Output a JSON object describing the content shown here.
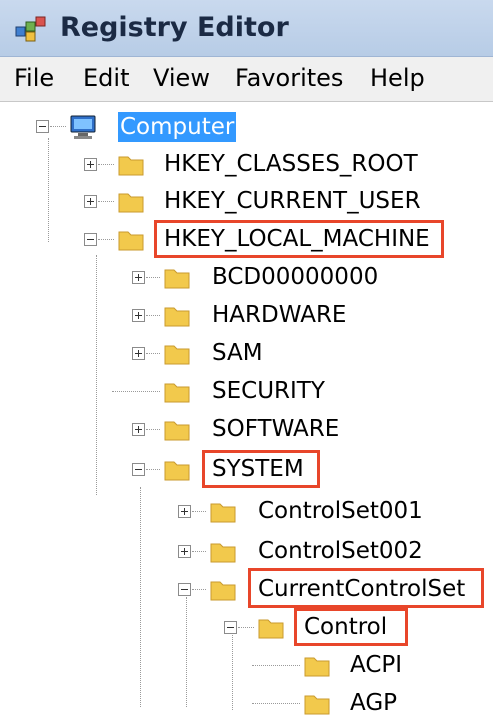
{
  "window": {
    "title": "Registry Editor"
  },
  "menu": [
    "File",
    "Edit",
    "View",
    "Favorites",
    "Help"
  ],
  "tree": {
    "root": "Computer",
    "hives": {
      "classes_root": "HKEY_CLASSES_ROOT",
      "current_user": "HKEY_CURRENT_USER",
      "local_machine": "HKEY_LOCAL_MACHINE"
    },
    "hklm_children": {
      "bcd": "BCD00000000",
      "hardware": "HARDWARE",
      "sam": "SAM",
      "security": "SECURITY",
      "software": "SOFTWARE",
      "system": "SYSTEM"
    },
    "system_children": {
      "cs001": "ControlSet001",
      "cs002": "ControlSet002",
      "ccs": "CurrentControlSet"
    },
    "ccs_children": {
      "control": "Control"
    },
    "control_children": {
      "acpi": "ACPI",
      "agp": "AGP"
    }
  },
  "colors": {
    "highlight_box": "#e8462a",
    "selection": "#3399ff",
    "folder": "#f2c94c"
  },
  "icons": {
    "app": "registry-editor-icon",
    "root": "computer-icon",
    "folder": "folder-icon"
  }
}
